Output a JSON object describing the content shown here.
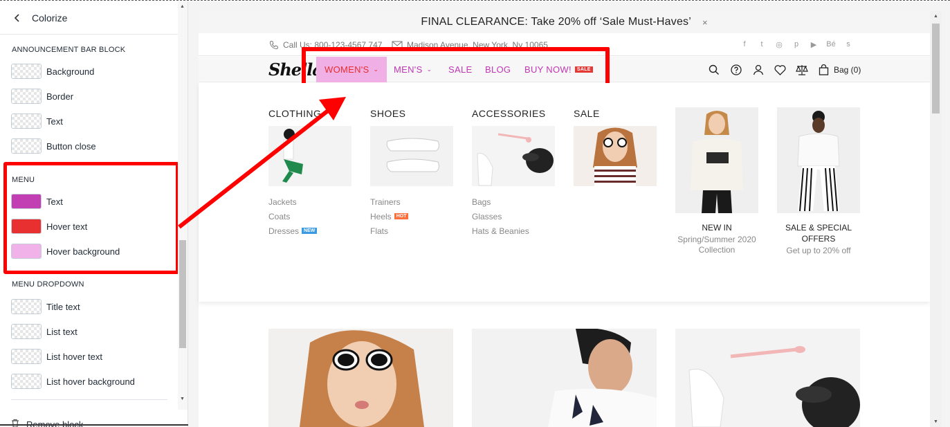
{
  "panel": {
    "title": "Colorize",
    "sections": {
      "announcement": {
        "label": "ANNOUNCEMENT BAR BLOCK",
        "items": [
          "Background",
          "Border",
          "Text",
          "Button close"
        ]
      },
      "menu": {
        "label": "MENU",
        "items": [
          {
            "label": "Text",
            "color": "#c23fb3"
          },
          {
            "label": "Hover text",
            "color": "#e83030"
          },
          {
            "label": "Hover background",
            "color": "#f0b2e8"
          }
        ]
      },
      "menu_dropdown": {
        "label": "MENU DROPDOWN",
        "items": [
          "Title text",
          "List text",
          "List hover text",
          "List hover background"
        ]
      }
    },
    "remove_label": "Remove block"
  },
  "site": {
    "announcement": "FINAL CLEARANCE: Take 20% off ‘Sale Must-Haves’",
    "close": "×",
    "phone": "Call Us: 800-123-4567 747",
    "address": "Madison Avenue, New York, Ny 10065",
    "socials": [
      "f",
      "t",
      "◎",
      "p",
      "▶",
      "Bé",
      "s"
    ],
    "logo": "Shella",
    "nav": {
      "womens": "WOMEN'S",
      "mens": "MEN'S",
      "sale": "SALE",
      "blog": "BLOG",
      "buy": "BUY NOW!",
      "buy_badge": "SALE",
      "chevron": "⌄"
    },
    "bag": "Bag (0)",
    "mega": {
      "clothing": {
        "title": "CLOTHING",
        "links": [
          "Jackets",
          "Coats",
          "Dresses"
        ],
        "tag": "NEW"
      },
      "shoes": {
        "title": "SHOES",
        "links": [
          "Trainers",
          "Heels",
          "Flats"
        ],
        "tag": "HOT"
      },
      "accessories": {
        "title": "ACCESSORIES",
        "links": [
          "Bags",
          "Glasses",
          "Hats & Beanies"
        ]
      },
      "sale": {
        "title": "SALE"
      }
    },
    "promo1": {
      "title": "NEW IN",
      "sub1": "Spring/Summer 2020",
      "sub2": "Collection"
    },
    "promo2": {
      "title1": "SALE & SPECIAL",
      "title2": "OFFERS",
      "sub": "Get up to 20% off"
    }
  },
  "colors": {
    "menu_text": "#c23fb3",
    "menu_hover_text": "#e83030",
    "menu_hover_bg": "#f0b2e8",
    "highlight": "#ff0000"
  }
}
